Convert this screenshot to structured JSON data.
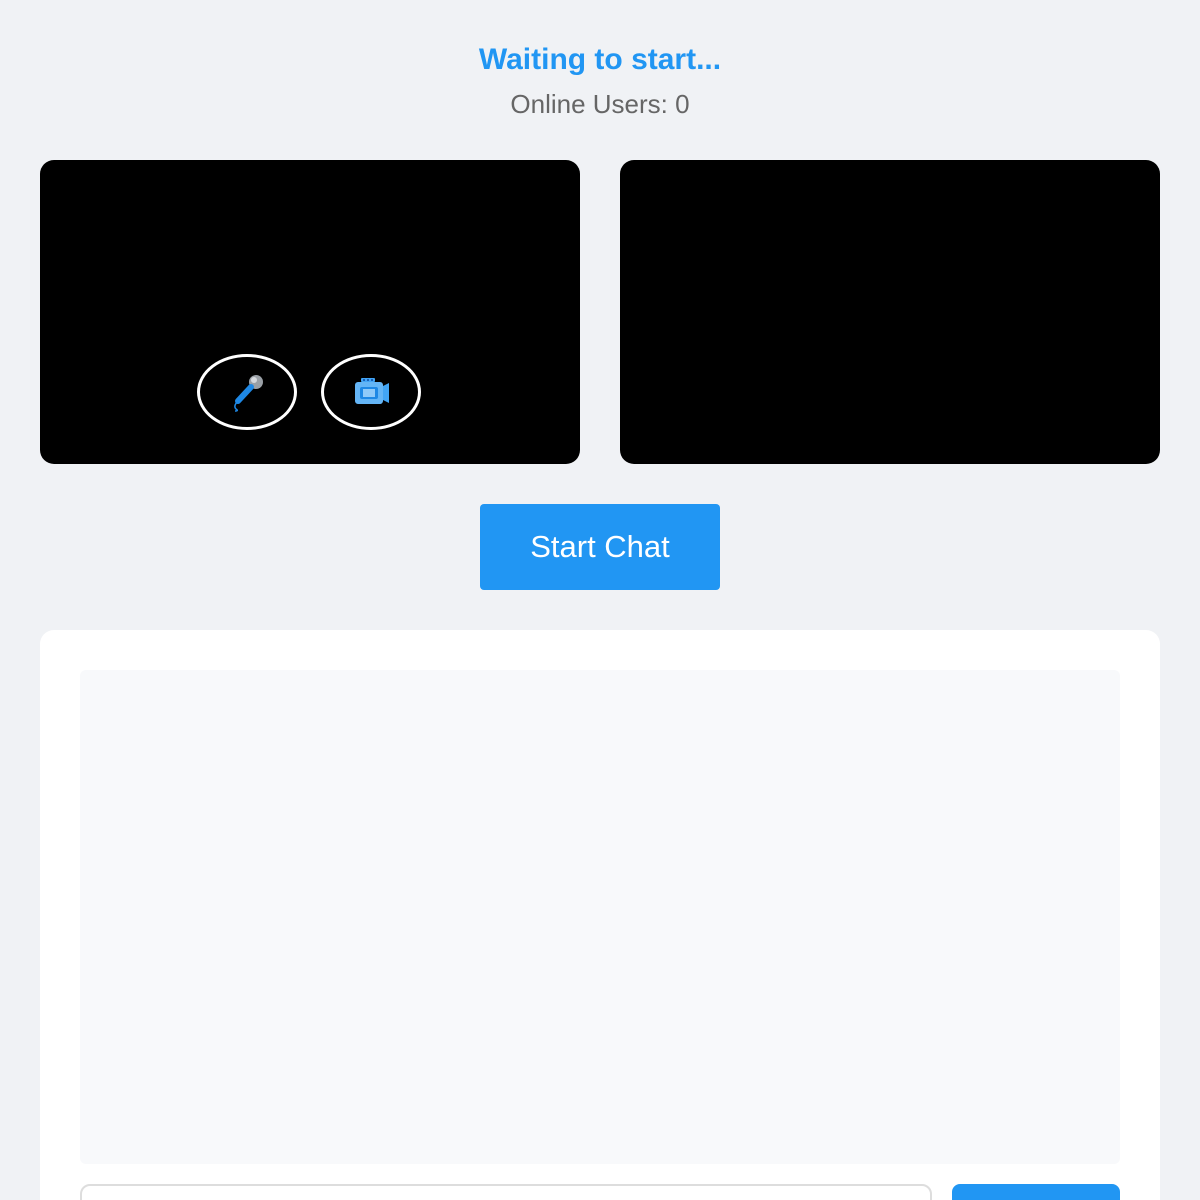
{
  "header": {
    "status_text": "Waiting to start...",
    "online_label": "Online Users: ",
    "online_count": "0"
  },
  "controls": {
    "mic_icon": "microphone-icon",
    "camera_icon": "video-camera-icon"
  },
  "actions": {
    "start_label": "Start Chat"
  },
  "chat": {
    "input_value": "",
    "send_label": ""
  },
  "colors": {
    "accent": "#2196f3",
    "background": "#f0f2f5",
    "video_bg": "#000000",
    "muted_text": "#666666"
  }
}
